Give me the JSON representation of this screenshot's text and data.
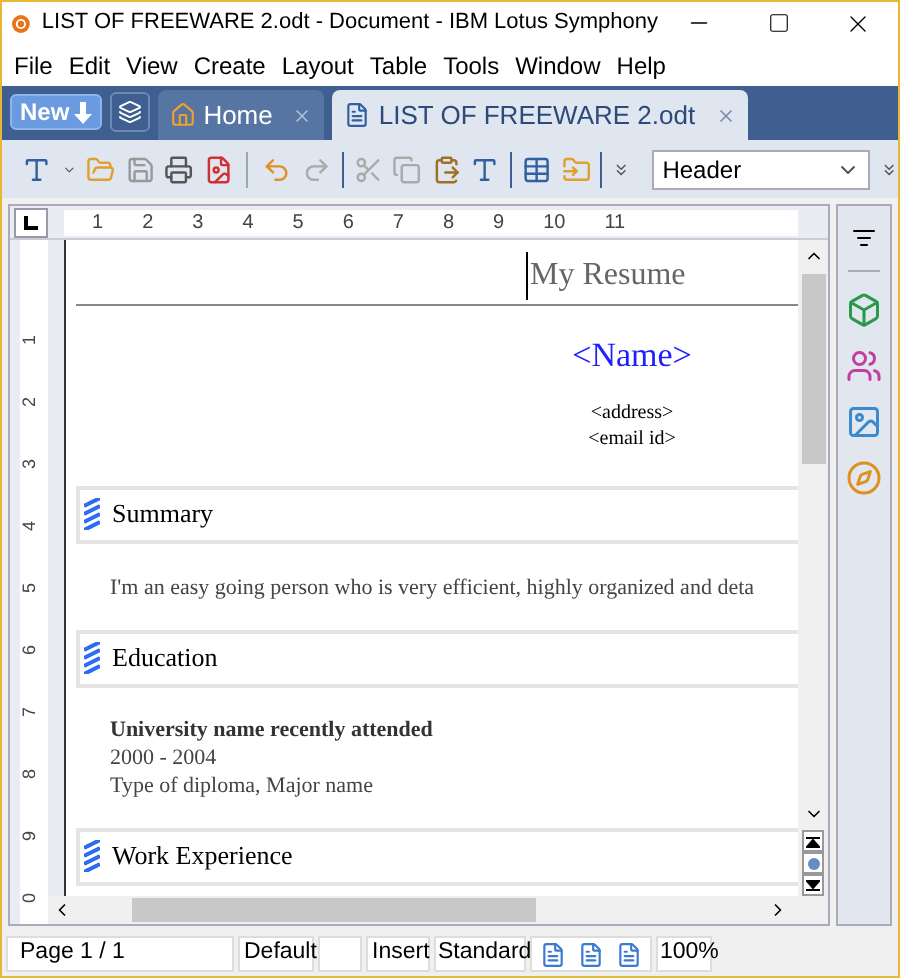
{
  "window": {
    "title": "LIST OF FREEWARE 2.odt - Document - IBM Lotus Symphony"
  },
  "menu": [
    "File",
    "Edit",
    "View",
    "Create",
    "Layout",
    "Table",
    "Tools",
    "Window",
    "Help"
  ],
  "tab_bar": {
    "new_button": "New",
    "tabs": [
      {
        "label": "Home",
        "kind": "home",
        "selected": false
      },
      {
        "label": "LIST OF FREEWARE 2.odt",
        "kind": "document",
        "selected": true
      }
    ]
  },
  "toolbar": {
    "style_dropdown": "Header"
  },
  "ruler": {
    "horizontal": [
      "1",
      "2",
      "3",
      "4",
      "5",
      "6",
      "7",
      "8",
      "9",
      "10",
      "11"
    ],
    "vertical": [
      "1",
      "2",
      "3",
      "4",
      "5",
      "6",
      "7",
      "8",
      "9",
      "0"
    ]
  },
  "document": {
    "header": "My Resume",
    "name": "<Name>",
    "contact": [
      "<address>",
      "<email id>"
    ],
    "sections": [
      {
        "heading": "Summary",
        "lines": [
          {
            "text": "I'm an easy going person who is very efficient, highly organized and deta",
            "bold": false
          }
        ]
      },
      {
        "heading": "Education",
        "lines": [
          {
            "text": "University name recently attended",
            "bold": true
          },
          {
            "text": "2000 - 2004",
            "bold": false
          },
          {
            "text": "Type of diploma, Major name",
            "bold": false
          }
        ]
      },
      {
        "heading": "Work Experience"
      }
    ]
  },
  "status_bar": {
    "page": "Page 1 / 1",
    "style": "Default",
    "mode": "Insert",
    "selection": "Standard",
    "zoom": "100%"
  }
}
